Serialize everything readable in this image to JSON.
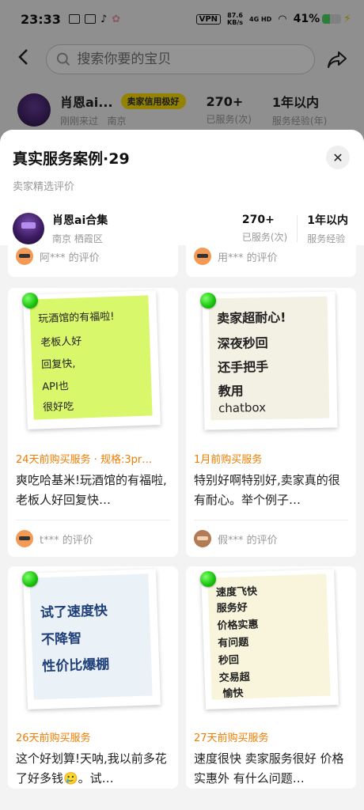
{
  "status": {
    "time": "23:33",
    "vpn": "VPN",
    "net_speed": "87.6",
    "net_unit": "KB/s",
    "net_type": "4G HD",
    "battery_pct": "41%",
    "battery_level": 0.41
  },
  "search": {
    "back_icon": "back-arrow-icon",
    "placeholder": "搜索你要的宝贝",
    "share_icon": "share-icon"
  },
  "bg_seller": {
    "name": "肖恩ai...",
    "credit_badge": "卖家信用极好",
    "visited": "刚刚来过",
    "city": "南京",
    "served_value": "270+",
    "served_label": "已服务(次)",
    "exp_value": "1年以内",
    "exp_label": "服务经验(年)"
  },
  "sheet": {
    "title": "真实服务案例·29",
    "subtitle": "卖家精选评价",
    "close_icon": "close-icon",
    "seller": {
      "name": "肖恩ai合集",
      "location": "南京 栖霞区",
      "served_value": "270+",
      "served_label": "已服务(次)",
      "exp_value": "1年以内",
      "exp_label": "服务经验"
    }
  },
  "top_reviewers": [
    {
      "name": "阿*** 的评价"
    },
    {
      "name": "用*** 的评价"
    }
  ],
  "cards": [
    {
      "note_lines": [
        "玩酒馆的有福啦!",
        "老板人好",
        "回复快,",
        "API也",
        "很好吃"
      ],
      "meta": "24天前购买服务 · 规格:3pr…",
      "text": "爽吃哈基米!玩酒馆的有福啦,老板人好回复快…",
      "reviewer": "t*** 的评价"
    },
    {
      "note_lines": [
        "卖家超耐心!",
        "深夜秒回",
        "还手把手",
        "教用",
        "chatbox"
      ],
      "meta": "1月前购买服务",
      "text": "特别好啊特别好,卖家真的很有耐心。举个例子…",
      "reviewer": "假*** 的评价"
    },
    {
      "note_lines": [
        "试了速度快",
        "不降智",
        "性价比爆棚"
      ],
      "meta": "26天前购买服务",
      "text": "这个好划算!天呐,我以前多花了好多钱🥲。试…",
      "reviewer": ""
    },
    {
      "note_lines": [
        "速度飞快",
        "服务好",
        "价格实惠",
        "有问题",
        "秒回",
        "交易超",
        "愉快"
      ],
      "meta": "27天前购买服务",
      "text": "速度很快 卖家服务很好 价格实惠外 有什么问题…",
      "reviewer": ""
    }
  ],
  "colors": {
    "accent_orange": "#f07c00",
    "credit_yellow": "#ffe100",
    "pin_green": "#17c10b",
    "note_green": "#d9f76a",
    "note_cream": "#f3f0e4",
    "note_blue": "#eaf1f7",
    "note_yellow": "#f8f5dc"
  }
}
